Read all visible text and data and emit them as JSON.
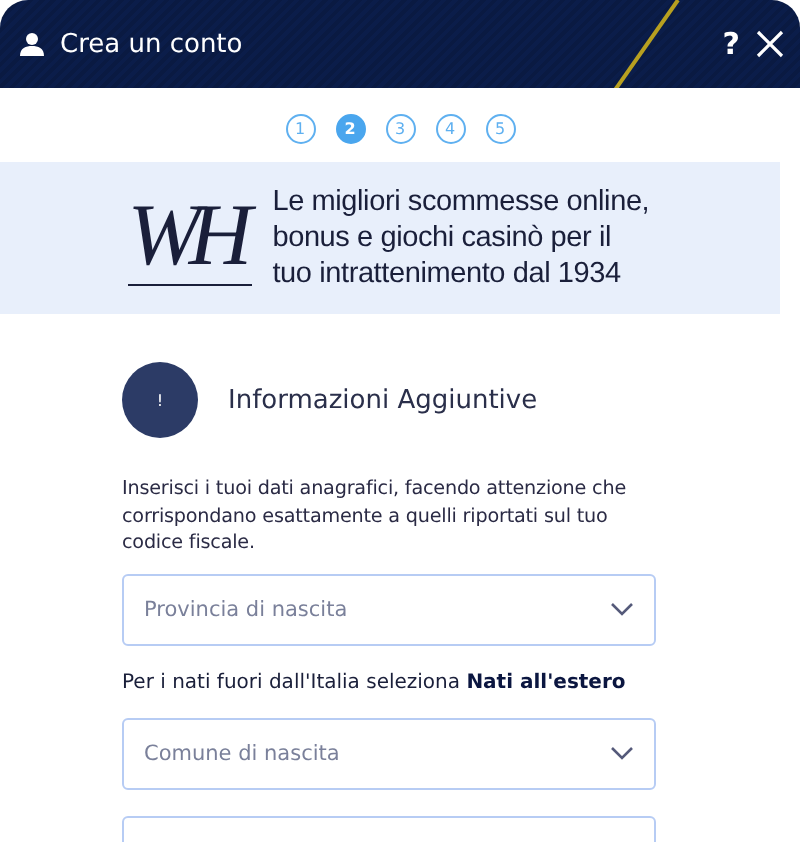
{
  "header": {
    "title": "Crea un conto",
    "help": "?"
  },
  "steps": [
    {
      "label": "1",
      "selected": false
    },
    {
      "label": "2",
      "selected": true
    },
    {
      "label": "3",
      "selected": false
    },
    {
      "label": "4",
      "selected": false
    },
    {
      "label": "5",
      "selected": false
    }
  ],
  "banner": {
    "logo": "WH",
    "tagline": "Le migliori scommesse online, bonus e giochi casinò per il tuo intrattenimento dal 1934"
  },
  "section": {
    "badge": "!",
    "title": "Informazioni Aggiuntive",
    "intro": "Inserisci i tuoi dati anagrafici, facendo attenzione che corrispondano esattamente a quelli riportati sul tuo codice fiscale."
  },
  "form": [
    {
      "kind": "select",
      "placeholder": "Provincia di nascita"
    },
    {
      "kind": "note",
      "text": "Per i nati fuori dall'Italia seleziona **Nati all'estero**"
    },
    {
      "kind": "select",
      "placeholder": "Comune di nascita"
    },
    {
      "kind": "select"
    }
  ]
}
